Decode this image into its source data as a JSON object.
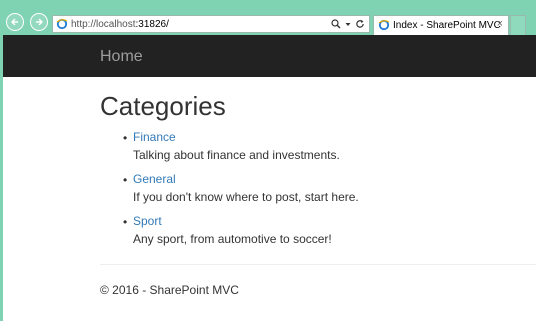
{
  "browser": {
    "address_host": "http://localhost",
    "address_port": ":31826/",
    "tab_title": "Index - SharePoint MVC",
    "tab_close": "×",
    "colors": {
      "chrome": "#7fd3b3",
      "navbar": "#222222",
      "link": "#337ab7"
    }
  },
  "navbar": {
    "brand": "Home"
  },
  "page": {
    "title": "Categories",
    "bullet": "•",
    "categories": [
      {
        "name": "Finance",
        "description": "Talking about finance and investments."
      },
      {
        "name": "General",
        "description": "If you don't know where to post, start here."
      },
      {
        "name": "Sport",
        "description": "Any sport, from automotive to soccer!"
      }
    ]
  },
  "footer": {
    "text": "© 2016 - SharePoint MVC"
  },
  "icons": [
    "back-arrow-icon",
    "forward-arrow-icon",
    "ie-favicon-icon",
    "search-icon",
    "dropdown-icon",
    "refresh-icon"
  ]
}
